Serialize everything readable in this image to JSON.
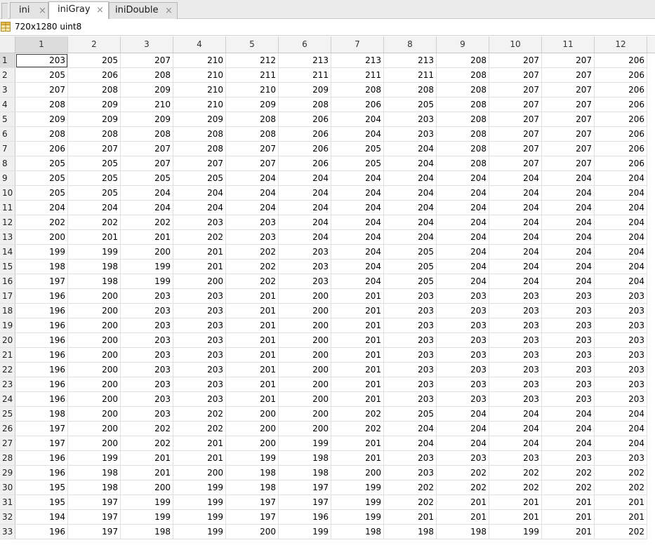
{
  "tabs": [
    {
      "label": "ini",
      "active": false
    },
    {
      "label": "iniGray",
      "active": true
    },
    {
      "label": "iniDouble",
      "active": false
    }
  ],
  "close_glyph": "×",
  "variable_info": "720x1280 uint8",
  "icons": {
    "variable": "grid-table-icon",
    "close": "close-icon"
  },
  "columns": [
    "1",
    "2",
    "3",
    "4",
    "5",
    "6",
    "7",
    "8",
    "9",
    "10",
    "11",
    "12"
  ],
  "selected_cell": {
    "row": 1,
    "col": 1
  },
  "rows": [
    {
      "label": "1",
      "values": [
        203,
        205,
        207,
        210,
        212,
        213,
        213,
        213,
        208,
        207,
        207,
        206
      ]
    },
    {
      "label": "2",
      "values": [
        205,
        206,
        208,
        210,
        211,
        211,
        211,
        211,
        208,
        207,
        207,
        206
      ]
    },
    {
      "label": "3",
      "values": [
        207,
        208,
        209,
        210,
        210,
        209,
        208,
        208,
        208,
        207,
        207,
        206
      ]
    },
    {
      "label": "4",
      "values": [
        208,
        209,
        210,
        210,
        209,
        208,
        206,
        205,
        208,
        207,
        207,
        206
      ]
    },
    {
      "label": "5",
      "values": [
        209,
        209,
        209,
        209,
        208,
        206,
        204,
        203,
        208,
        207,
        207,
        206
      ]
    },
    {
      "label": "6",
      "values": [
        208,
        208,
        208,
        208,
        208,
        206,
        204,
        203,
        208,
        207,
        207,
        206
      ]
    },
    {
      "label": "7",
      "values": [
        206,
        207,
        207,
        208,
        207,
        206,
        205,
        204,
        208,
        207,
        207,
        206
      ]
    },
    {
      "label": "8",
      "values": [
        205,
        205,
        207,
        207,
        207,
        206,
        205,
        204,
        208,
        207,
        207,
        206
      ]
    },
    {
      "label": "9",
      "values": [
        205,
        205,
        205,
        205,
        204,
        204,
        204,
        204,
        204,
        204,
        204,
        204
      ]
    },
    {
      "label": "10",
      "values": [
        205,
        205,
        204,
        204,
        204,
        204,
        204,
        204,
        204,
        204,
        204,
        204
      ]
    },
    {
      "label": "11",
      "values": [
        204,
        204,
        204,
        204,
        204,
        204,
        204,
        204,
        204,
        204,
        204,
        204
      ]
    },
    {
      "label": "12",
      "values": [
        202,
        202,
        202,
        203,
        203,
        204,
        204,
        204,
        204,
        204,
        204,
        204
      ]
    },
    {
      "label": "13",
      "values": [
        200,
        201,
        201,
        202,
        203,
        204,
        204,
        204,
        204,
        204,
        204,
        204
      ]
    },
    {
      "label": "14",
      "values": [
        199,
        199,
        200,
        201,
        202,
        203,
        204,
        205,
        204,
        204,
        204,
        204
      ]
    },
    {
      "label": "15",
      "values": [
        198,
        198,
        199,
        201,
        202,
        203,
        204,
        205,
        204,
        204,
        204,
        204
      ]
    },
    {
      "label": "16",
      "values": [
        197,
        198,
        199,
        200,
        202,
        203,
        204,
        205,
        204,
        204,
        204,
        204
      ]
    },
    {
      "label": "17",
      "values": [
        196,
        200,
        203,
        203,
        201,
        200,
        201,
        203,
        203,
        203,
        203,
        203
      ]
    },
    {
      "label": "18",
      "values": [
        196,
        200,
        203,
        203,
        201,
        200,
        201,
        203,
        203,
        203,
        203,
        203
      ]
    },
    {
      "label": "19",
      "values": [
        196,
        200,
        203,
        203,
        201,
        200,
        201,
        203,
        203,
        203,
        203,
        203
      ]
    },
    {
      "label": "20",
      "values": [
        196,
        200,
        203,
        203,
        201,
        200,
        201,
        203,
        203,
        203,
        203,
        203
      ]
    },
    {
      "label": "21",
      "values": [
        196,
        200,
        203,
        203,
        201,
        200,
        201,
        203,
        203,
        203,
        203,
        203
      ]
    },
    {
      "label": "22",
      "values": [
        196,
        200,
        203,
        203,
        201,
        200,
        201,
        203,
        203,
        203,
        203,
        203
      ]
    },
    {
      "label": "23",
      "values": [
        196,
        200,
        203,
        203,
        201,
        200,
        201,
        203,
        203,
        203,
        203,
        203
      ]
    },
    {
      "label": "24",
      "values": [
        196,
        200,
        203,
        203,
        201,
        200,
        201,
        203,
        203,
        203,
        203,
        203
      ]
    },
    {
      "label": "25",
      "values": [
        198,
        200,
        203,
        202,
        200,
        200,
        202,
        205,
        204,
        204,
        204,
        204
      ]
    },
    {
      "label": "26",
      "values": [
        197,
        200,
        202,
        202,
        200,
        200,
        202,
        204,
        204,
        204,
        204,
        204
      ]
    },
    {
      "label": "27",
      "values": [
        197,
        200,
        202,
        201,
        200,
        199,
        201,
        204,
        204,
        204,
        204,
        204
      ]
    },
    {
      "label": "28",
      "values": [
        196,
        199,
        201,
        201,
        199,
        198,
        201,
        203,
        203,
        203,
        203,
        203
      ]
    },
    {
      "label": "29",
      "values": [
        196,
        198,
        201,
        200,
        198,
        198,
        200,
        203,
        202,
        202,
        202,
        202
      ]
    },
    {
      "label": "30",
      "values": [
        195,
        198,
        200,
        199,
        198,
        197,
        199,
        202,
        202,
        202,
        202,
        202
      ]
    },
    {
      "label": "31",
      "values": [
        195,
        197,
        199,
        199,
        197,
        197,
        199,
        202,
        201,
        201,
        201,
        201
      ]
    },
    {
      "label": "32",
      "values": [
        194,
        197,
        199,
        199,
        197,
        196,
        199,
        201,
        201,
        201,
        201,
        201
      ]
    },
    {
      "label": "33",
      "values": [
        196,
        197,
        198,
        199,
        200,
        199,
        198,
        198,
        198,
        199,
        201,
        202
      ]
    }
  ]
}
